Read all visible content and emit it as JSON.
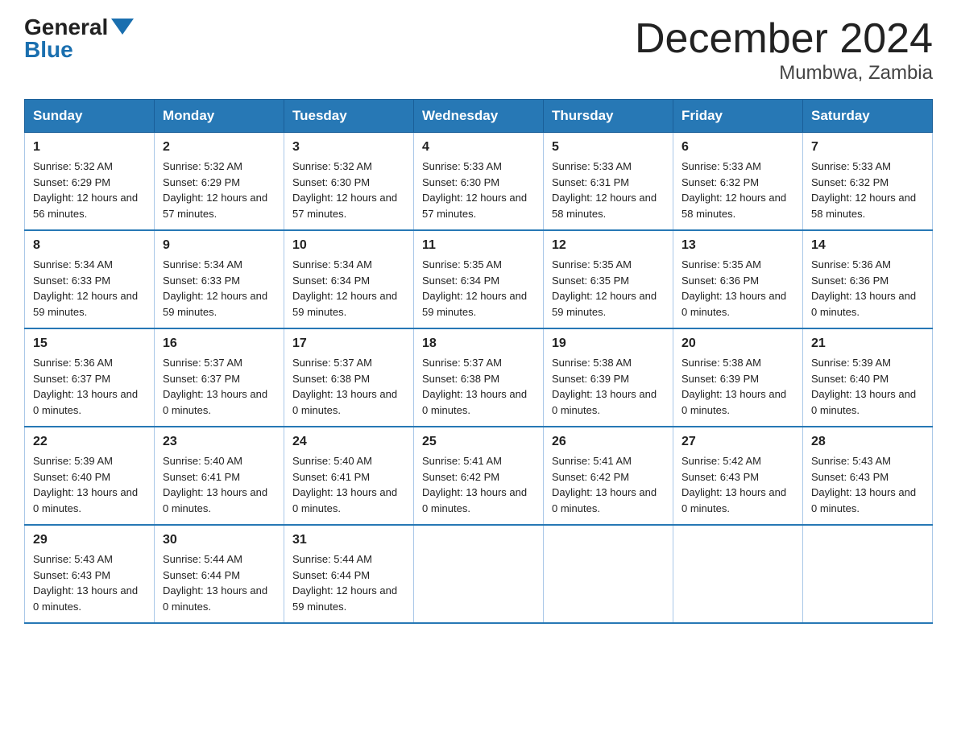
{
  "header": {
    "logo_general": "General",
    "logo_blue": "Blue",
    "month_title": "December 2024",
    "location": "Mumbwa, Zambia"
  },
  "days_of_week": [
    "Sunday",
    "Monday",
    "Tuesday",
    "Wednesday",
    "Thursday",
    "Friday",
    "Saturday"
  ],
  "weeks": [
    [
      {
        "day": "1",
        "sunrise": "5:32 AM",
        "sunset": "6:29 PM",
        "daylight": "12 hours and 56 minutes."
      },
      {
        "day": "2",
        "sunrise": "5:32 AM",
        "sunset": "6:29 PM",
        "daylight": "12 hours and 57 minutes."
      },
      {
        "day": "3",
        "sunrise": "5:32 AM",
        "sunset": "6:30 PM",
        "daylight": "12 hours and 57 minutes."
      },
      {
        "day": "4",
        "sunrise": "5:33 AM",
        "sunset": "6:30 PM",
        "daylight": "12 hours and 57 minutes."
      },
      {
        "day": "5",
        "sunrise": "5:33 AM",
        "sunset": "6:31 PM",
        "daylight": "12 hours and 58 minutes."
      },
      {
        "day": "6",
        "sunrise": "5:33 AM",
        "sunset": "6:32 PM",
        "daylight": "12 hours and 58 minutes."
      },
      {
        "day": "7",
        "sunrise": "5:33 AM",
        "sunset": "6:32 PM",
        "daylight": "12 hours and 58 minutes."
      }
    ],
    [
      {
        "day": "8",
        "sunrise": "5:34 AM",
        "sunset": "6:33 PM",
        "daylight": "12 hours and 59 minutes."
      },
      {
        "day": "9",
        "sunrise": "5:34 AM",
        "sunset": "6:33 PM",
        "daylight": "12 hours and 59 minutes."
      },
      {
        "day": "10",
        "sunrise": "5:34 AM",
        "sunset": "6:34 PM",
        "daylight": "12 hours and 59 minutes."
      },
      {
        "day": "11",
        "sunrise": "5:35 AM",
        "sunset": "6:34 PM",
        "daylight": "12 hours and 59 minutes."
      },
      {
        "day": "12",
        "sunrise": "5:35 AM",
        "sunset": "6:35 PM",
        "daylight": "12 hours and 59 minutes."
      },
      {
        "day": "13",
        "sunrise": "5:35 AM",
        "sunset": "6:36 PM",
        "daylight": "13 hours and 0 minutes."
      },
      {
        "day": "14",
        "sunrise": "5:36 AM",
        "sunset": "6:36 PM",
        "daylight": "13 hours and 0 minutes."
      }
    ],
    [
      {
        "day": "15",
        "sunrise": "5:36 AM",
        "sunset": "6:37 PM",
        "daylight": "13 hours and 0 minutes."
      },
      {
        "day": "16",
        "sunrise": "5:37 AM",
        "sunset": "6:37 PM",
        "daylight": "13 hours and 0 minutes."
      },
      {
        "day": "17",
        "sunrise": "5:37 AM",
        "sunset": "6:38 PM",
        "daylight": "13 hours and 0 minutes."
      },
      {
        "day": "18",
        "sunrise": "5:37 AM",
        "sunset": "6:38 PM",
        "daylight": "13 hours and 0 minutes."
      },
      {
        "day": "19",
        "sunrise": "5:38 AM",
        "sunset": "6:39 PM",
        "daylight": "13 hours and 0 minutes."
      },
      {
        "day": "20",
        "sunrise": "5:38 AM",
        "sunset": "6:39 PM",
        "daylight": "13 hours and 0 minutes."
      },
      {
        "day": "21",
        "sunrise": "5:39 AM",
        "sunset": "6:40 PM",
        "daylight": "13 hours and 0 minutes."
      }
    ],
    [
      {
        "day": "22",
        "sunrise": "5:39 AM",
        "sunset": "6:40 PM",
        "daylight": "13 hours and 0 minutes."
      },
      {
        "day": "23",
        "sunrise": "5:40 AM",
        "sunset": "6:41 PM",
        "daylight": "13 hours and 0 minutes."
      },
      {
        "day": "24",
        "sunrise": "5:40 AM",
        "sunset": "6:41 PM",
        "daylight": "13 hours and 0 minutes."
      },
      {
        "day": "25",
        "sunrise": "5:41 AM",
        "sunset": "6:42 PM",
        "daylight": "13 hours and 0 minutes."
      },
      {
        "day": "26",
        "sunrise": "5:41 AM",
        "sunset": "6:42 PM",
        "daylight": "13 hours and 0 minutes."
      },
      {
        "day": "27",
        "sunrise": "5:42 AM",
        "sunset": "6:43 PM",
        "daylight": "13 hours and 0 minutes."
      },
      {
        "day": "28",
        "sunrise": "5:43 AM",
        "sunset": "6:43 PM",
        "daylight": "13 hours and 0 minutes."
      }
    ],
    [
      {
        "day": "29",
        "sunrise": "5:43 AM",
        "sunset": "6:43 PM",
        "daylight": "13 hours and 0 minutes."
      },
      {
        "day": "30",
        "sunrise": "5:44 AM",
        "sunset": "6:44 PM",
        "daylight": "13 hours and 0 minutes."
      },
      {
        "day": "31",
        "sunrise": "5:44 AM",
        "sunset": "6:44 PM",
        "daylight": "12 hours and 59 minutes."
      },
      null,
      null,
      null,
      null
    ]
  ],
  "labels": {
    "sunrise": "Sunrise: ",
    "sunset": "Sunset: ",
    "daylight": "Daylight: "
  }
}
